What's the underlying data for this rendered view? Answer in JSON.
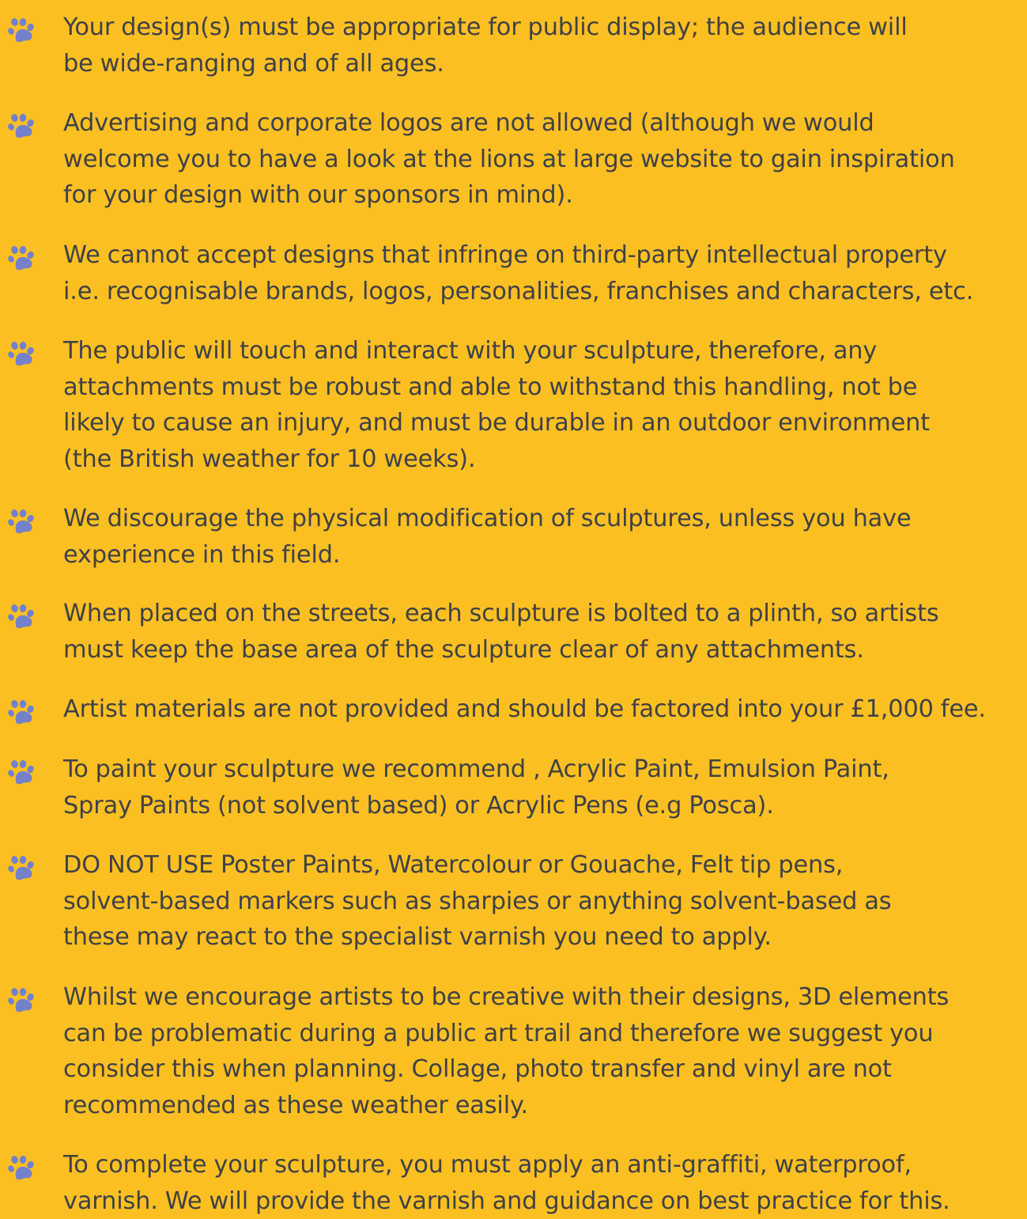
{
  "accent_color": "#FBBF22",
  "icon_color": "#7480C9",
  "text_color": "#404145",
  "bullet_icon": "paw-print-icon",
  "rules": [
    {
      "lines": [
        "Your design(s) must be appropriate for public display; the audience will",
        "be wide-ranging and of all ages."
      ]
    },
    {
      "lines": [
        "Advertising and corporate logos are not allowed (although we would",
        "welcome you to have a look at the lions at large website to gain inspiration",
        "for your design with our sponsors in mind)."
      ]
    },
    {
      "lines": [
        "We cannot accept designs that infringe on third-party intellectual property",
        "i.e. recognisable brands, logos, personalities, franchises and characters, etc."
      ]
    },
    {
      "lines": [
        "The public will touch and interact with your sculpture, therefore, any",
        "attachments must be robust and able to withstand this handling, not be",
        "likely to cause an injury, and must be durable in an outdoor environment",
        "(the British weather for 10 weeks)."
      ]
    },
    {
      "lines": [
        "We discourage the physical modification of sculptures, unless you have",
        "experience in this field."
      ]
    },
    {
      "lines": [
        "When placed on the streets, each sculpture is bolted to a plinth, so artists",
        "must keep the base area of the sculpture clear of any attachments."
      ]
    },
    {
      "lines": [
        "Artist materials are not provided and should be factored into your £1,000 fee."
      ]
    },
    {
      "lines": [
        "To paint your sculpture we recommend , Acrylic Paint, Emulsion Paint,",
        "Spray Paints (not solvent based) or Acrylic Pens (e.g Posca)."
      ]
    },
    {
      "lines": [
        "DO NOT USE Poster Paints, Watercolour or Gouache, Felt tip pens,",
        "solvent-based markers such as sharpies or anything solvent-based as",
        "these may react to the specialist varnish you need to apply."
      ]
    },
    {
      "lines": [
        "Whilst we encourage artists to be creative with their designs, 3D elements",
        "can be problematic during a public art trail and therefore we suggest you",
        "consider this when planning. Collage, photo transfer and vinyl are not",
        "recommended as these weather easily."
      ]
    },
    {
      "lines": [
        "To complete your sculpture, you must apply an anti-graffiti, waterproof,",
        "varnish. We will provide the varnish and guidance on best practice for this."
      ]
    }
  ]
}
